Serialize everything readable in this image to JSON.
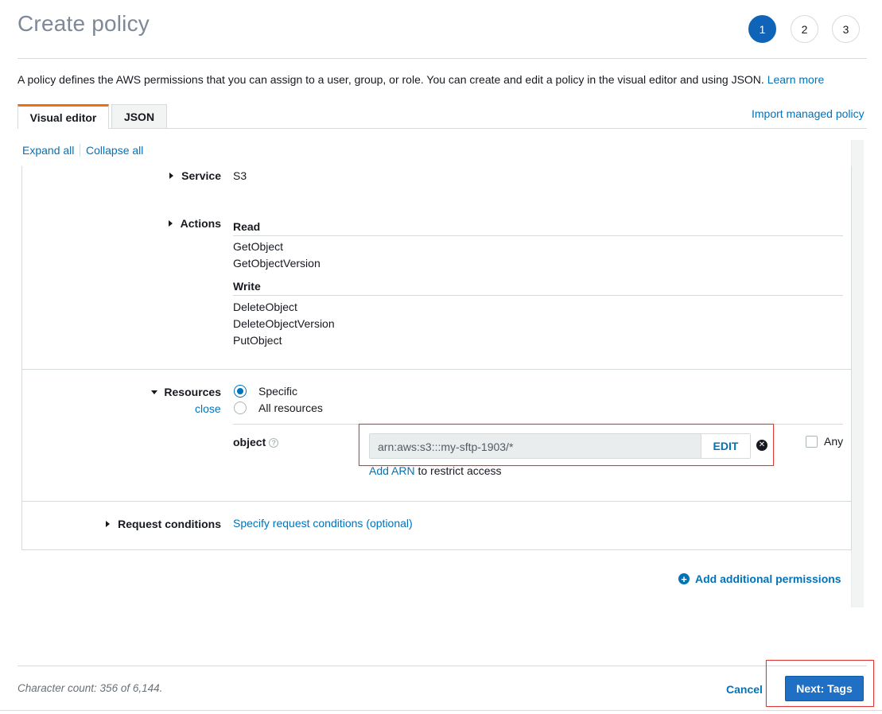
{
  "header": {
    "title": "Create policy",
    "steps": [
      "1",
      "2",
      "3"
    ],
    "active_step": "1"
  },
  "description": {
    "text": "A policy defines the AWS permissions that you can assign to a user, group, or role. You can create and edit a policy in the visual editor and using JSON.",
    "learn_more": "Learn more"
  },
  "tabs": [
    {
      "label": "Visual editor",
      "active": true
    },
    {
      "label": "JSON",
      "active": false
    }
  ],
  "import_link": "Import managed policy",
  "expand_all": "Expand all",
  "collapse_all": "Collapse all",
  "service": {
    "label": "Service",
    "value": "S3"
  },
  "actions": {
    "label": "Actions",
    "groups": [
      {
        "name": "Read",
        "items": [
          "GetObject",
          "GetObjectVersion"
        ]
      },
      {
        "name": "Write",
        "items": [
          "DeleteObject",
          "DeleteObjectVersion",
          "PutObject"
        ]
      }
    ]
  },
  "resources": {
    "label": "Resources",
    "close": "close",
    "options": [
      {
        "label": "Specific",
        "selected": true
      },
      {
        "label": "All resources",
        "selected": false
      }
    ],
    "object_label": "object",
    "arn_value": "arn:aws:s3:::my-sftp-1903/*",
    "edit_label": "EDIT",
    "any_label": "Any",
    "add_arn": "Add ARN",
    "add_arn_suffix": "to restrict access"
  },
  "request_conditions": {
    "label": "Request conditions",
    "link": "Specify request conditions (optional)"
  },
  "add_permissions": "Add additional permissions",
  "footer": {
    "char_count": "Character count: 356 of 6,144.",
    "cancel": "Cancel",
    "next": "Next: Tags"
  },
  "colors": {
    "accent": "#0073bb",
    "primary_button": "#1f6fc5",
    "active_tab": "#ec7211",
    "highlight": "#d93a3a"
  },
  "icons": [
    "caret-right-icon",
    "caret-down-icon",
    "help-icon",
    "remove-circle-icon",
    "plus-circle-icon"
  ]
}
